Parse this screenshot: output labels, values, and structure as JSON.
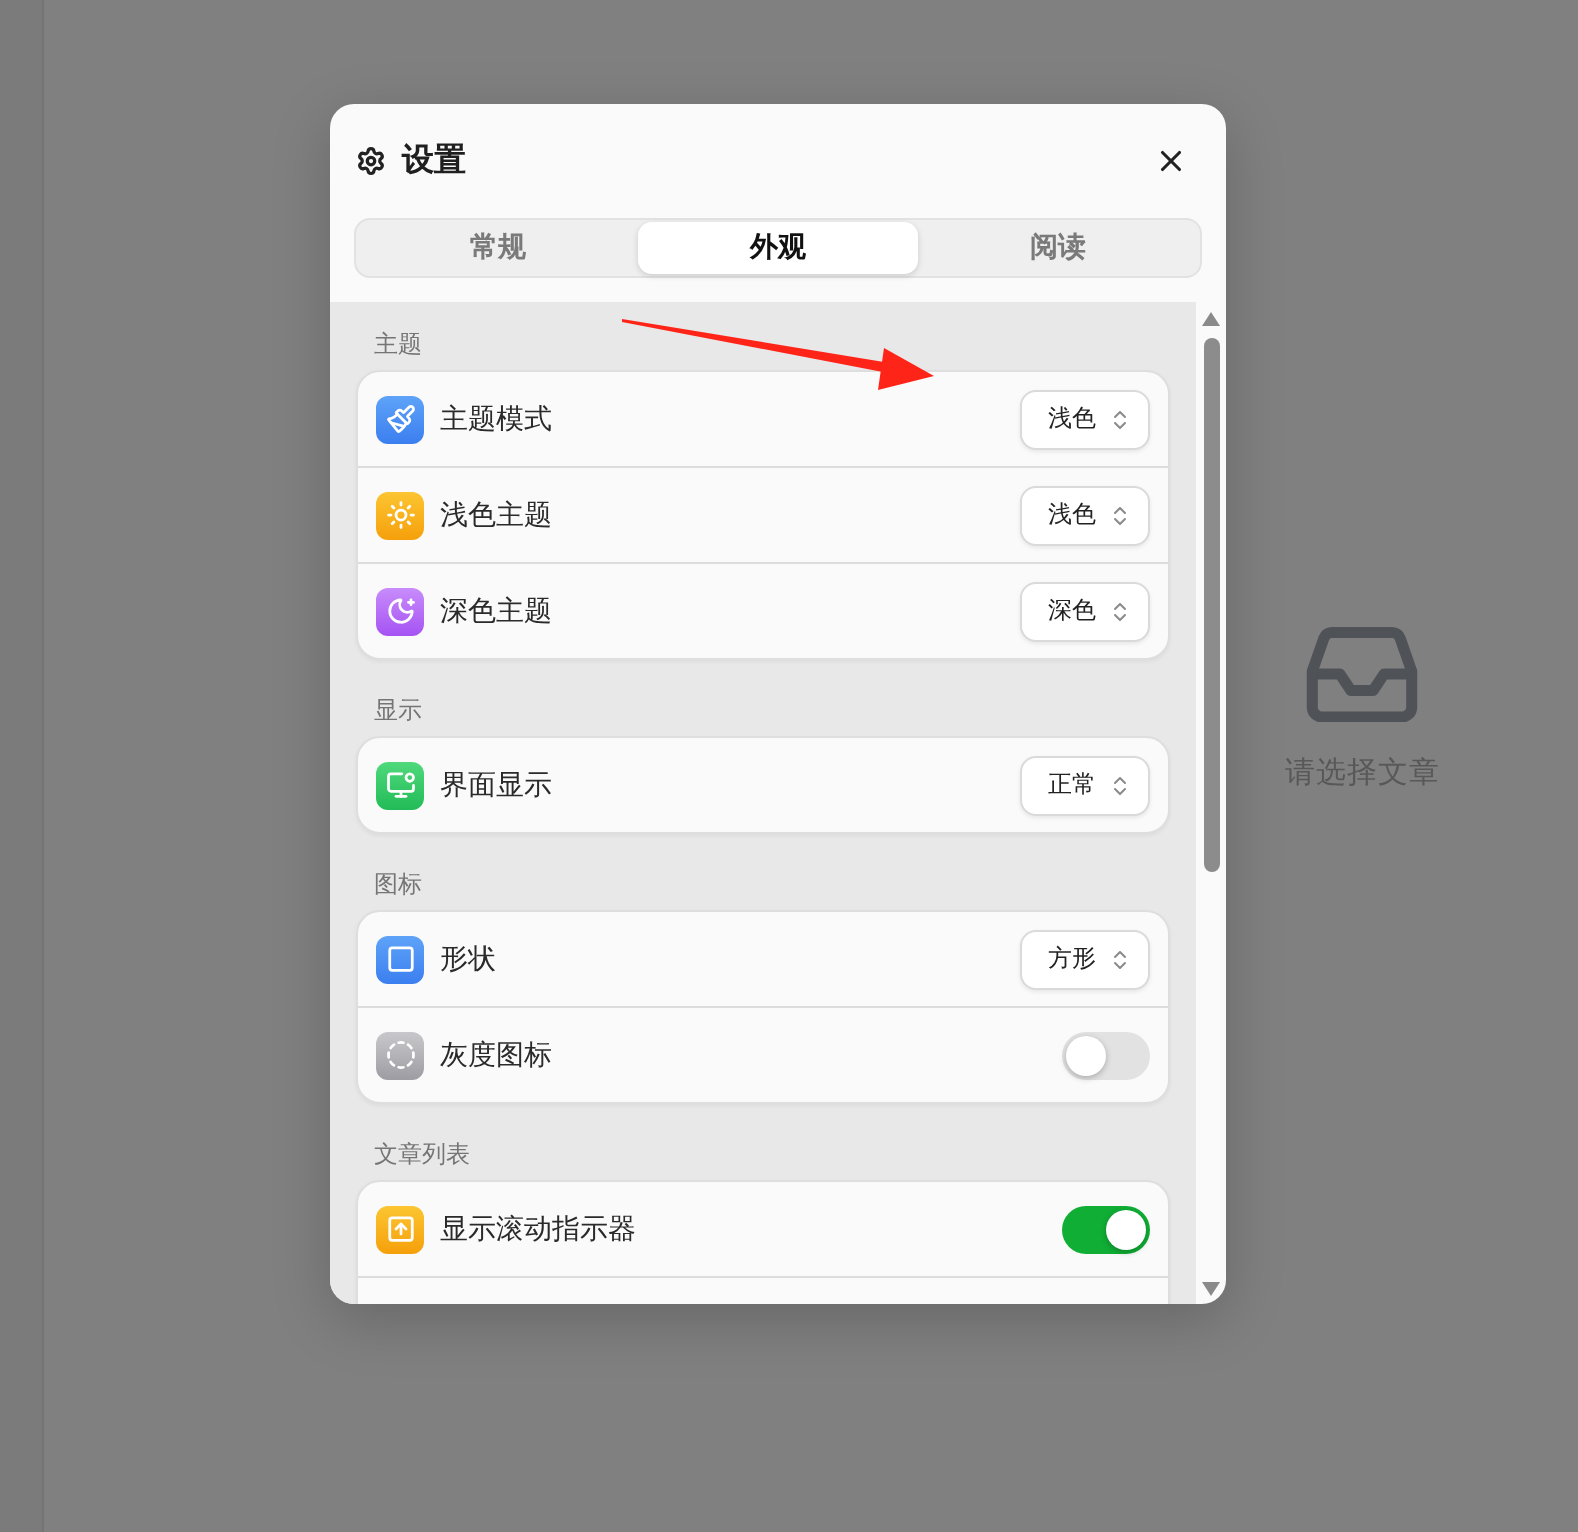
{
  "window": {
    "title": "设置"
  },
  "tabs": [
    {
      "label": "常规",
      "selected": false
    },
    {
      "label": "外观",
      "selected": true
    },
    {
      "label": "阅读",
      "selected": false
    }
  ],
  "sections": [
    {
      "title": "主题",
      "rows": [
        {
          "label": "主题模式",
          "kind": "select",
          "value": "浅色"
        },
        {
          "label": "浅色主题",
          "kind": "select",
          "value": "浅色"
        },
        {
          "label": "深色主题",
          "kind": "select",
          "value": "深色"
        }
      ]
    },
    {
      "title": "显示",
      "rows": [
        {
          "label": "界面显示",
          "kind": "select",
          "value": "正常"
        }
      ]
    },
    {
      "title": "图标",
      "rows": [
        {
          "label": "形状",
          "kind": "select",
          "value": "方形"
        },
        {
          "label": "灰度图标",
          "kind": "toggle",
          "on": false
        }
      ]
    },
    {
      "title": "文章列表",
      "rows": [
        {
          "label": "显示滚动指示器",
          "kind": "toggle",
          "on": true
        }
      ],
      "continues": true
    }
  ],
  "empty_state": {
    "message": "请选择文章"
  }
}
